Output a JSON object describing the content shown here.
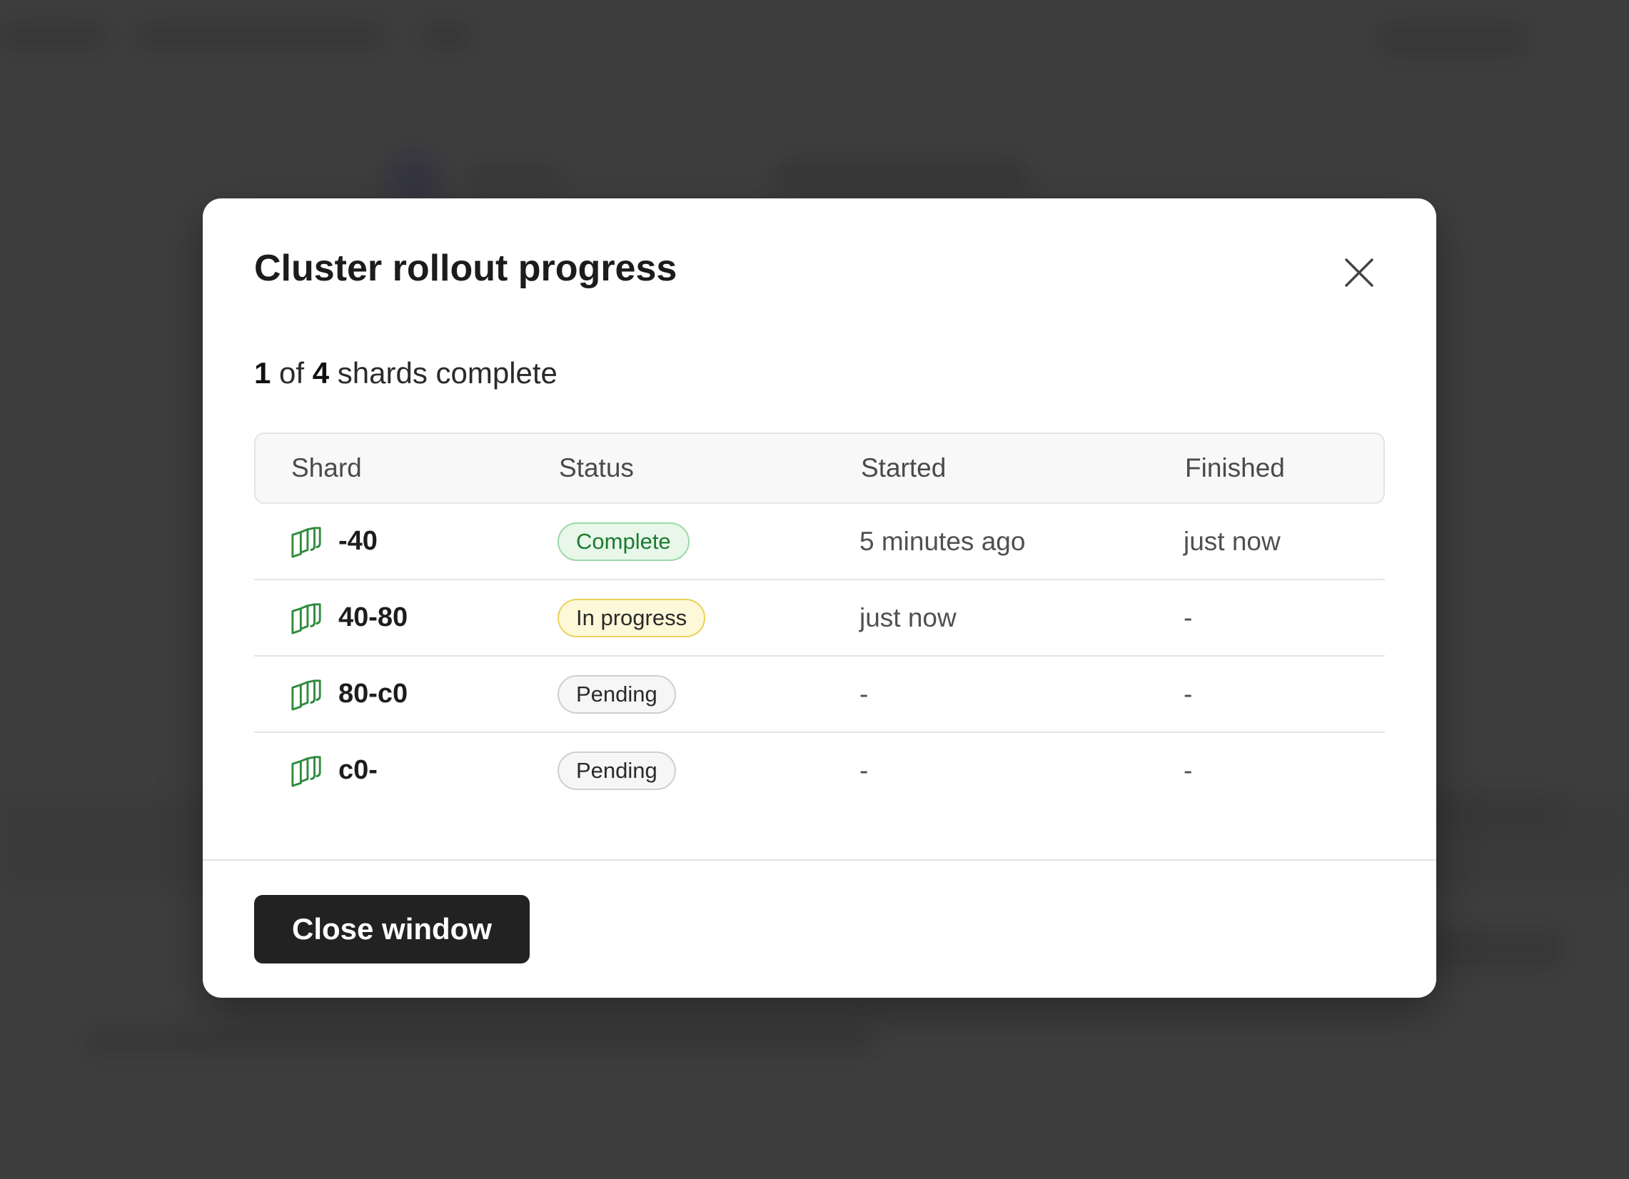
{
  "modal": {
    "title": "Cluster rollout progress",
    "summary": {
      "done": "1",
      "of": "of",
      "total": "4",
      "suffix": "shards complete"
    },
    "columns": [
      "Shard",
      "Status",
      "Started",
      "Finished"
    ],
    "rows": [
      {
        "shard": "-40",
        "status": "Complete",
        "status_kind": "complete",
        "started": "5 minutes ago",
        "finished": "just now"
      },
      {
        "shard": "40-80",
        "status": "In progress",
        "status_kind": "progress",
        "started": "just now",
        "finished": "-"
      },
      {
        "shard": "80-c0",
        "status": "Pending",
        "status_kind": "pending",
        "started": "-",
        "finished": "-"
      },
      {
        "shard": "c0-",
        "status": "Pending",
        "status_kind": "pending",
        "started": "-",
        "finished": "-"
      }
    ],
    "close_button": "Close window",
    "icons": {
      "close": "close-icon",
      "shard": "shard-icon"
    },
    "colors": {
      "shard_icon": "#2e8b3d",
      "primary_button": "#222222"
    }
  }
}
